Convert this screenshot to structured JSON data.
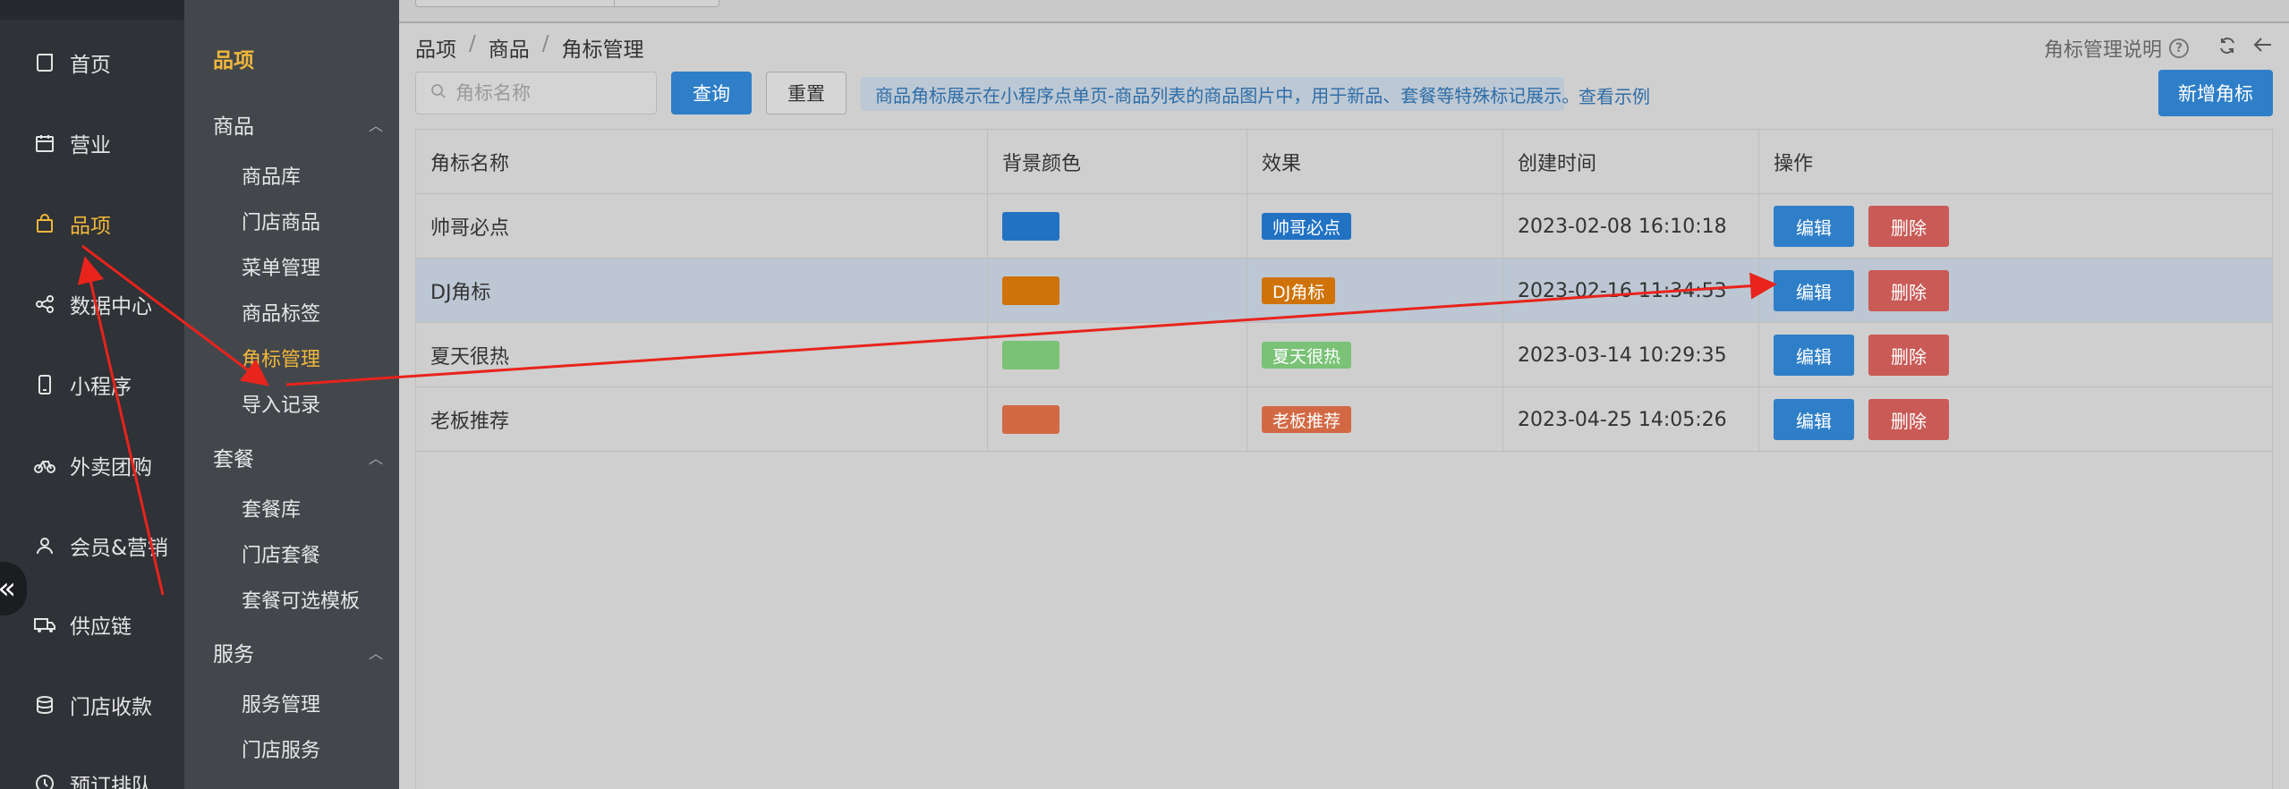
{
  "nav1": {
    "items": [
      {
        "label": "首页",
        "icon": "home-icon"
      },
      {
        "label": "营业",
        "icon": "calendar-icon"
      },
      {
        "label": "品项",
        "icon": "bag-icon"
      },
      {
        "label": "数据中心",
        "icon": "share-icon"
      },
      {
        "label": "小程序",
        "icon": "phone-icon"
      },
      {
        "label": "外卖团购",
        "icon": "bike-icon"
      },
      {
        "label": "会员&营销",
        "icon": "user-icon"
      },
      {
        "label": "供应链",
        "icon": "truck-icon"
      },
      {
        "label": "门店收款",
        "icon": "database-icon"
      },
      {
        "label": "预订排队",
        "icon": "clock-icon"
      }
    ],
    "collapse_glyph": "«"
  },
  "nav2": {
    "title": "品项",
    "groups": [
      {
        "label": "商品",
        "items": [
          "商品库",
          "门店商品",
          "菜单管理",
          "商品标签",
          "角标管理",
          "导入记录"
        ]
      },
      {
        "label": "套餐",
        "items": [
          "套餐库",
          "门店套餐",
          "套餐可选模板"
        ]
      },
      {
        "label": "服务",
        "items": [
          "服务管理",
          "门店服务"
        ]
      }
    ]
  },
  "header": {
    "breadcrumb": [
      "品项",
      "商品",
      "角标管理"
    ],
    "help_label": "角标管理说明"
  },
  "toolbar": {
    "search_placeholder": "角标名称",
    "query_label": "查询",
    "reset_label": "重置",
    "notice": "商品角标展示在小程序点单页-商品列表的商品图片中，用于新品、套餐等特殊标记展示。",
    "view_example": "查看示例",
    "add_label": "新增角标"
  },
  "table": {
    "columns": [
      "角标名称",
      "背景颜色",
      "效果",
      "创建时间",
      "操作"
    ],
    "edit_label": "编辑",
    "delete_label": "删除",
    "rows": [
      {
        "name": "帅哥必点",
        "color": "#2272c4",
        "effect": "帅哥必点",
        "created": "2023-02-08 16:10:18"
      },
      {
        "name": "DJ角标",
        "color": "#cf7208",
        "effect": "DJ角标",
        "created": "2023-02-16 11:34:53"
      },
      {
        "name": "夏天很热",
        "color": "#7ac276",
        "effect": "夏天很热",
        "created": "2023-03-14 10:29:35"
      },
      {
        "name": "老板推荐",
        "color": "#d26944",
        "effect": "老板推荐",
        "created": "2023-04-25 14:05:26"
      }
    ]
  },
  "colors": {
    "accent": "#f0b73a",
    "primary": "#2f7fc8",
    "danger": "#c95a56",
    "annotation": "#e8241c"
  }
}
